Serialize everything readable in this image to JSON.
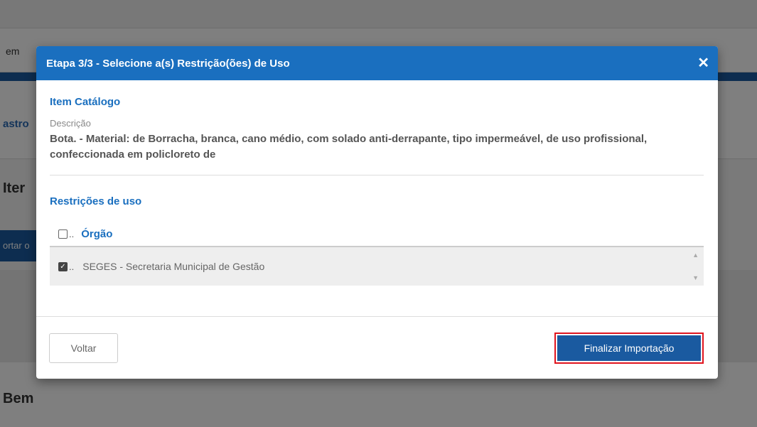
{
  "background": {
    "tab_text": "em",
    "cadastro_text": "astro",
    "item_title": "Iter",
    "button_text": "ortar o",
    "bem_title": "Bem"
  },
  "modal": {
    "title": "Etapa 3/3 - Selecione a(s) Restrição(ões) de Uso",
    "close_glyph": "✕",
    "item_section_title": "Item Catálogo",
    "description_label": "Descrição",
    "description_text": "Bota. - Material: de Borracha, branca, cano médio, com solado anti-derrapante, tipo impermeável, de uso profissional, confeccionada em policloreto de",
    "restrictions_title": "Restrições de uso",
    "table": {
      "header_dots": "..",
      "header_label": "Órgão",
      "rows": [
        {
          "checked": true,
          "dots": "..",
          "label": "SEGES - Secretaria Municipal de Gestão"
        }
      ]
    },
    "footer": {
      "back_label": "Voltar",
      "finish_label": "Finalizar Importação"
    }
  },
  "colors": {
    "header_blue": "#1a6fbf",
    "button_blue": "#1a5aa0",
    "highlight_red": "#e0141e"
  }
}
